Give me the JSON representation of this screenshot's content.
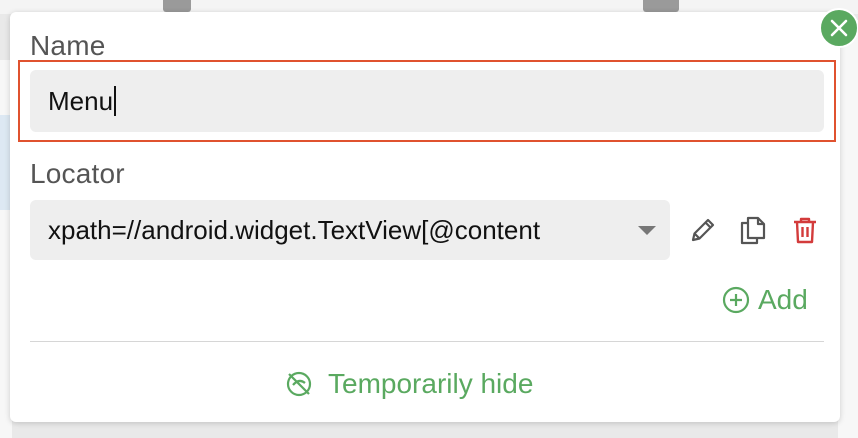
{
  "dialog": {
    "name_label": "Name",
    "name_value": "Menu",
    "locator_label": "Locator",
    "locator_value": "xpath=//android.widget.TextView[@content",
    "add_label": "Add",
    "hide_label": "Temporarily hide"
  },
  "icons": {
    "close": "close-icon",
    "edit": "pencil-icon",
    "copy": "copy-icon",
    "delete": "trash-icon",
    "add": "plus-circle-icon",
    "hide": "eye-off-icon",
    "dropdown": "caret-down-icon"
  },
  "colors": {
    "accent": "#5aa960",
    "delete": "#d33b3b",
    "highlight": "#e0522f"
  }
}
